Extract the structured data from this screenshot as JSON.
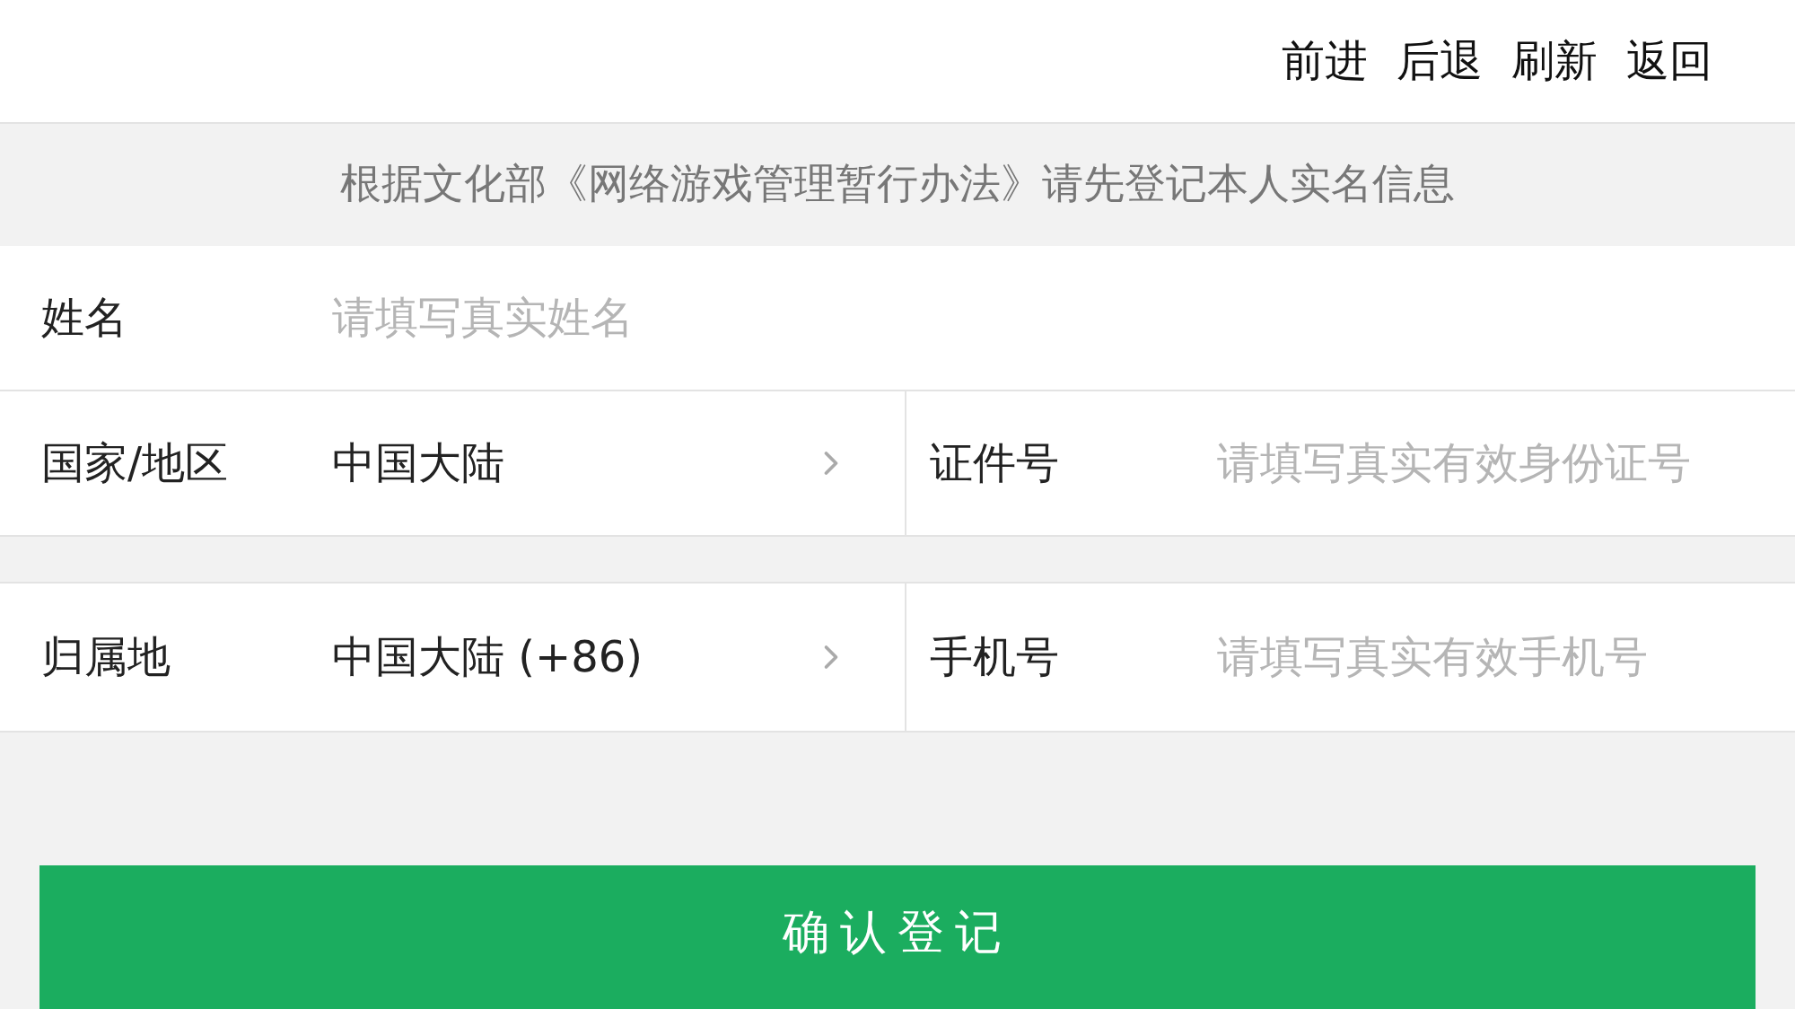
{
  "nav": [
    {
      "label": "前进"
    },
    {
      "label": "后退"
    },
    {
      "label": "刷新"
    },
    {
      "label": "返回"
    }
  ],
  "notice": "根据文化部《网络游戏管理暂行办法》请先登记本人实名信息",
  "name_field": {
    "label": "姓名",
    "placeholder": "请填写真实姓名"
  },
  "rows": [
    {
      "left": {
        "label": "国家/地区",
        "value": "中国大陆"
      },
      "right": {
        "label": "证件号",
        "placeholder": "请填写真实有效身份证号"
      }
    },
    {
      "left": {
        "label": "归属地",
        "value": "中国大陆 (+86)"
      },
      "right": {
        "label": "手机号",
        "placeholder": "请填写真实有效手机号"
      }
    }
  ],
  "submit": "确认登记"
}
